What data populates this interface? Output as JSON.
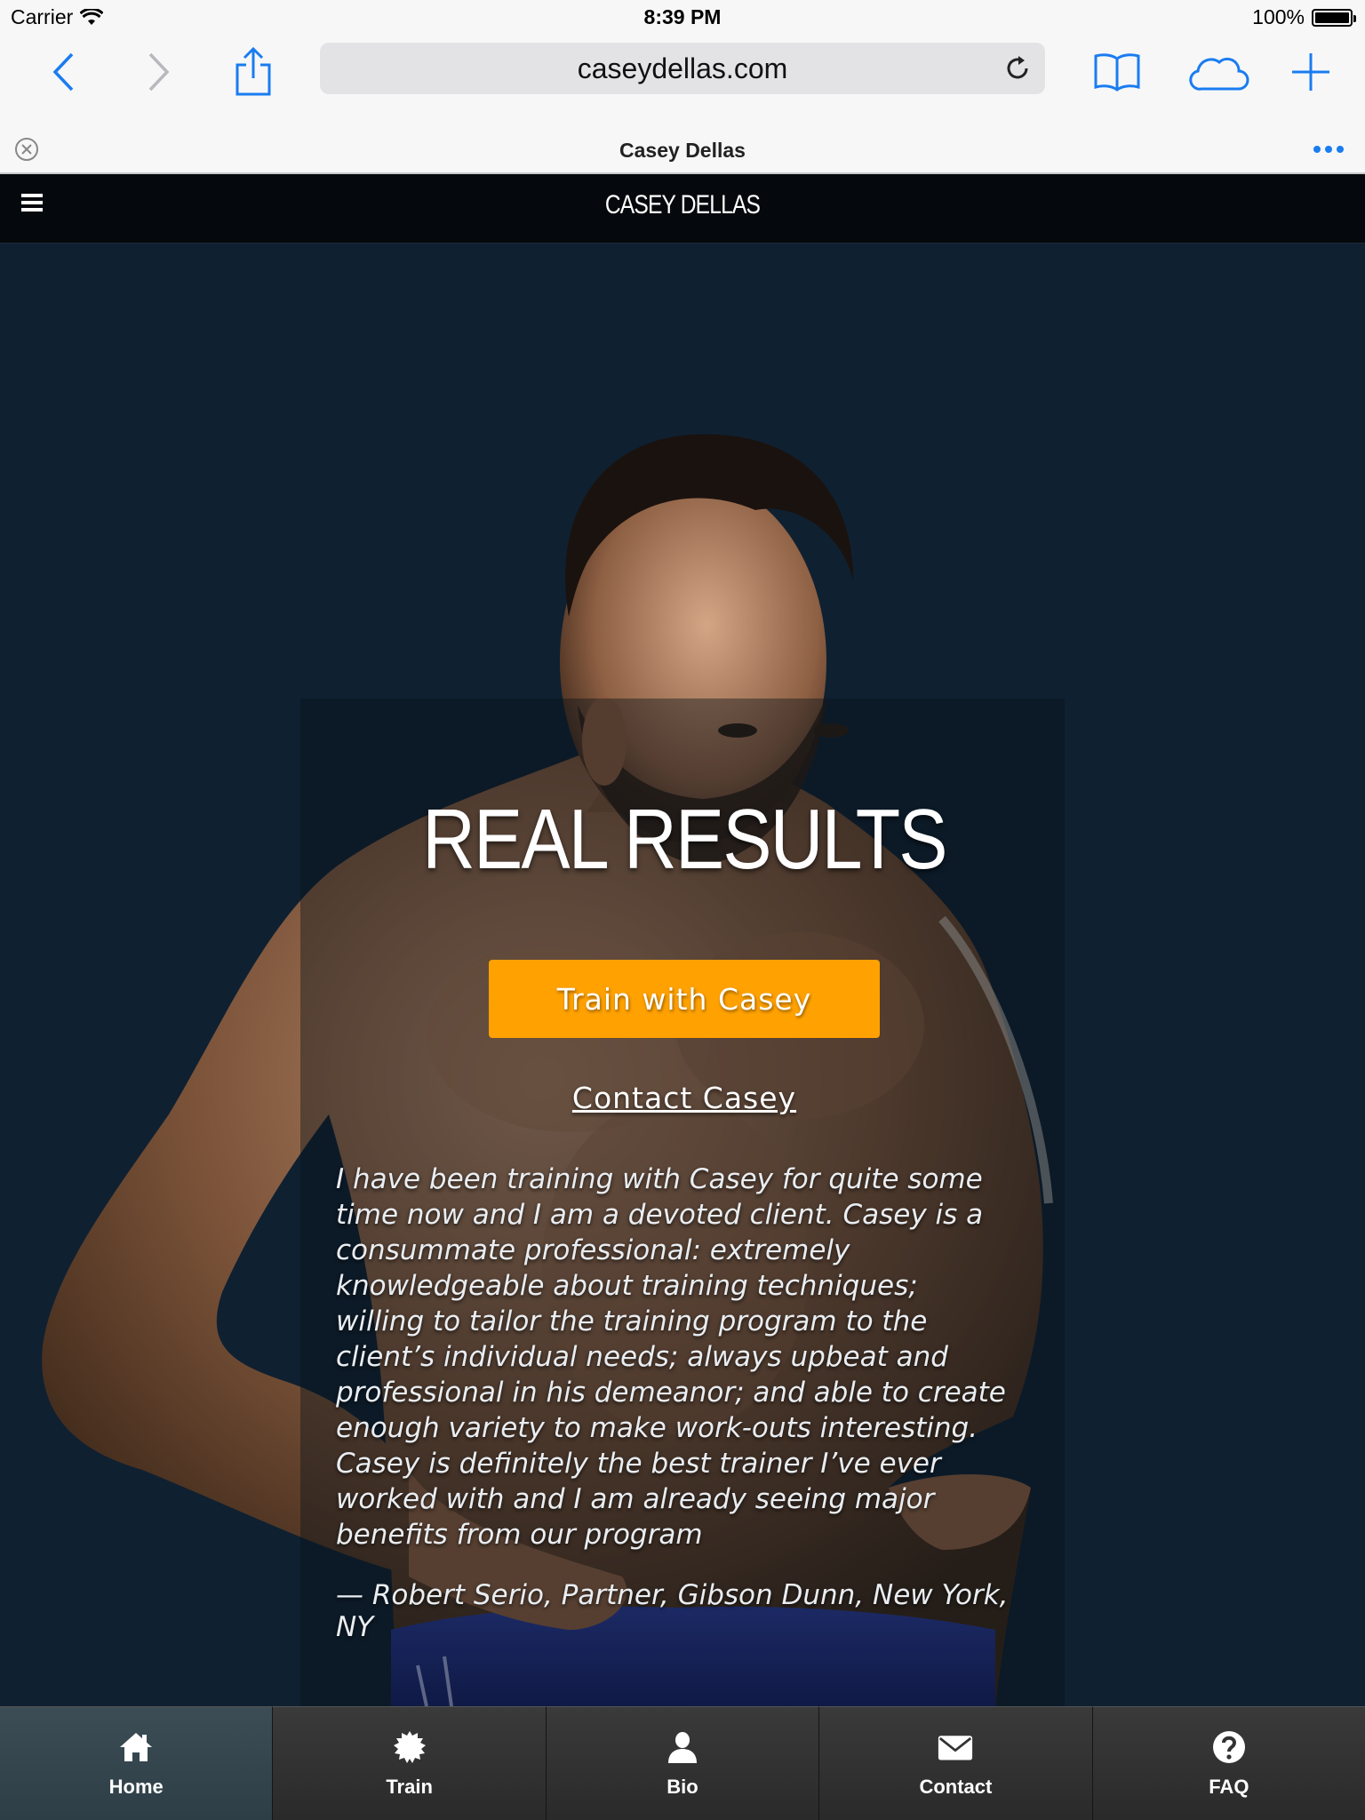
{
  "status_bar": {
    "carrier": "Carrier",
    "time": "8:39 PM",
    "battery": "100%",
    "battery_level": 1.0
  },
  "browser": {
    "url": "caseydellas.com",
    "tab_title": "Casey Dellas"
  },
  "site": {
    "title": "CASEY DELLAS"
  },
  "hero": {
    "headline": "REAL RESULTS",
    "cta_label": "Train with Casey",
    "contact_label": "Contact Casey",
    "testimonial_part1": "I have been training with Casey for quite some time now and I am a devoted client. Casey is a consummate professional: extremely knowledgeable about training techniques;",
    "testimonial_part2": "willing to tailor the training program to the client’s individual needs; always upbeat and professional in his demeanor; and able to create enough variety to make work-outs interesting. Casey is definitely the best trainer I’ve ever worked with and I am already seeing major benefits from our program",
    "attribution": "— Robert Serio, Partner, Gibson Dunn, New York, NY"
  },
  "tabbar": {
    "items": [
      {
        "label": "Home",
        "icon": "home-icon",
        "active": true
      },
      {
        "label": "Train",
        "icon": "gear-icon",
        "active": false
      },
      {
        "label": "Bio",
        "icon": "user-icon",
        "active": false
      },
      {
        "label": "Contact",
        "icon": "envelope-icon",
        "active": false
      },
      {
        "label": "FAQ",
        "icon": "question-icon",
        "active": false
      }
    ]
  },
  "colors": {
    "accent": "#ffa100",
    "safari_blue": "#1a7cf0",
    "hero_background": "#0f2031",
    "header_background": "#05080c"
  }
}
